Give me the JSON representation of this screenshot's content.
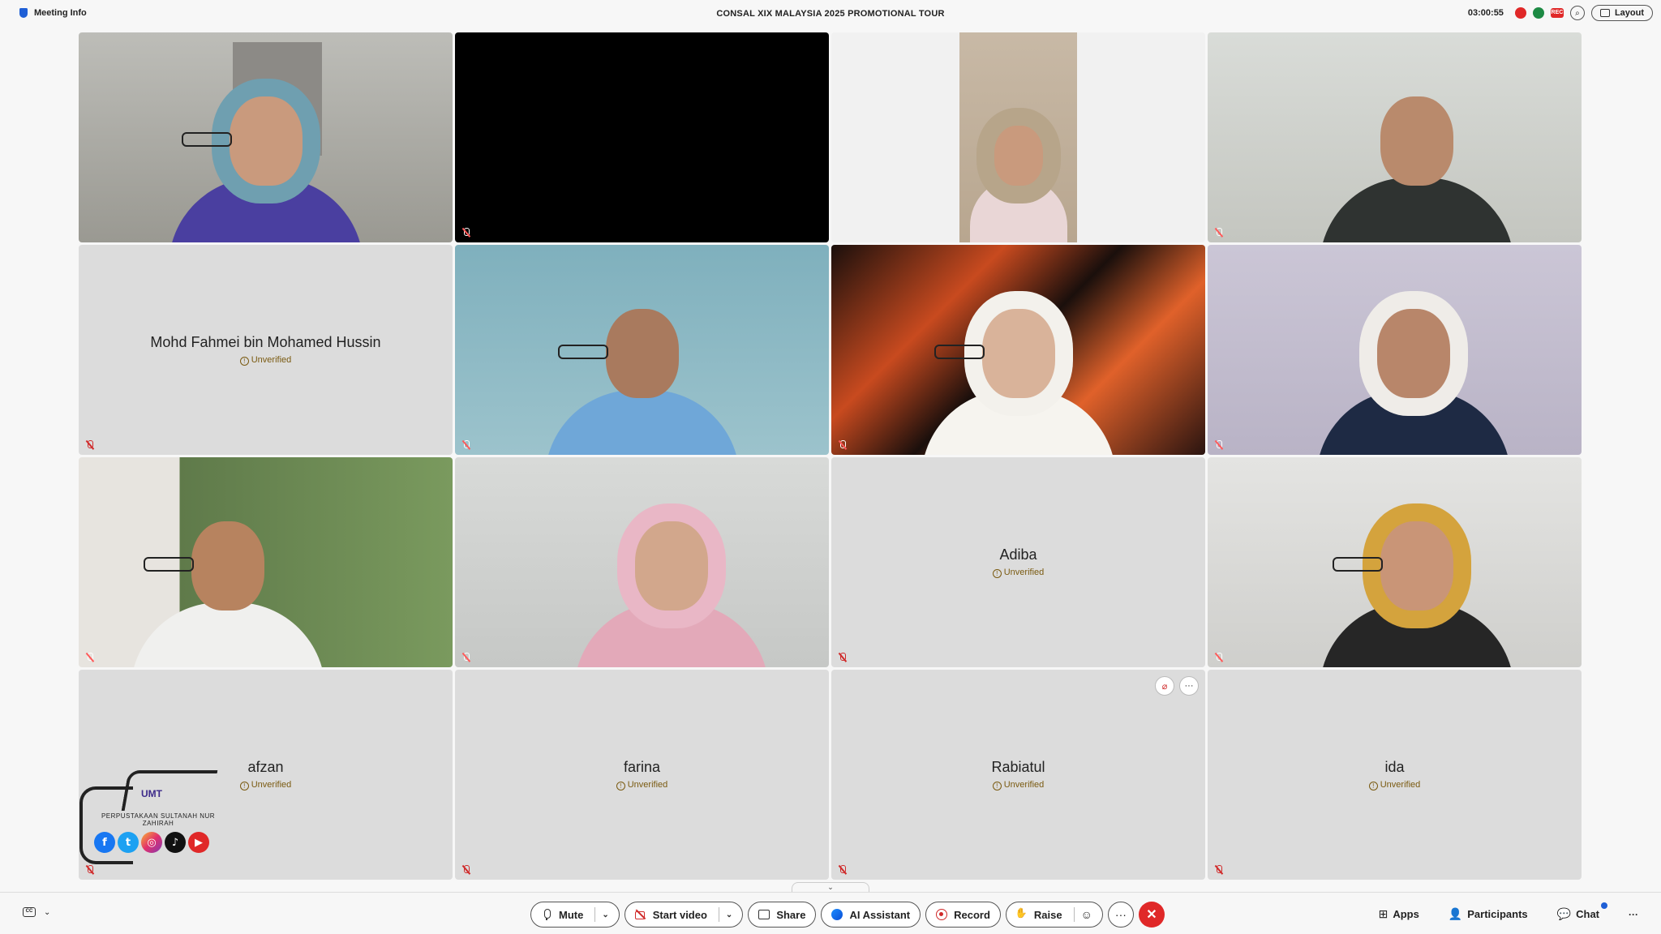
{
  "topbar": {
    "meeting_info": "Meeting Info",
    "title": "CONSAL XIX MALAYSIA 2025 PROMOTIONAL TOUR",
    "timer": "03:00:55",
    "rec_label": "REC",
    "layout_label": "Layout"
  },
  "tiles": {
    "t5": {
      "name": "Mohd Fahmei bin Mohamed Hussin",
      "status": "Unverified"
    },
    "t11": {
      "name": "Adiba",
      "status": "Unverified"
    },
    "t13": {
      "name": "afzan",
      "status": "Unverified"
    },
    "t14": {
      "name": "farina",
      "status": "Unverified"
    },
    "t15": {
      "name": "Rabiatul",
      "status": "Unverified"
    },
    "t16": {
      "name": "ida",
      "status": "Unverified"
    }
  },
  "logo": {
    "brand": "UMT",
    "library": "PERPUSTAKAAN SULTANAH NUR ZAHIRAH",
    "socials": [
      "facebook-icon",
      "twitter-icon",
      "instagram-icon",
      "tiktok-icon",
      "youtube-icon"
    ]
  },
  "toolbar": {
    "mute": "Mute",
    "start_video": "Start video",
    "share": "Share",
    "ai_assistant": "AI Assistant",
    "record": "Record",
    "raise": "Raise",
    "apps": "Apps",
    "participants": "Participants",
    "chat": "Chat"
  },
  "colors": {
    "end_button": "#e02828",
    "accent": "#1f5fd6",
    "tile_bg": "#dcdcdc",
    "unverified": "#7a5a10"
  }
}
